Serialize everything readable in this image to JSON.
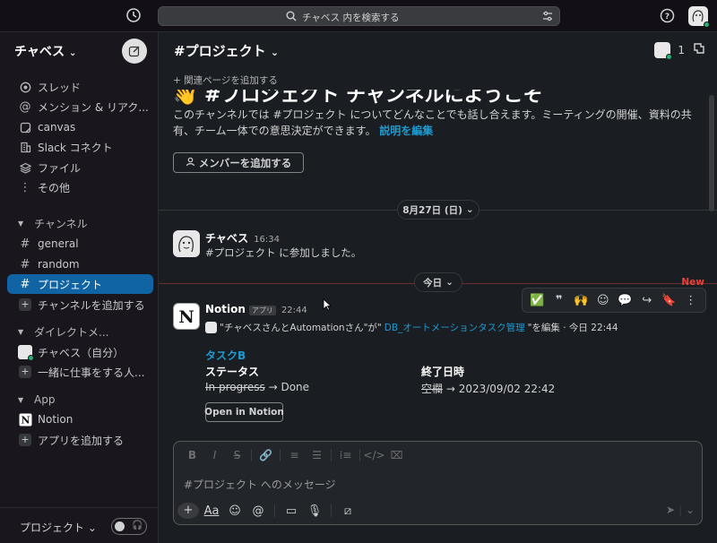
{
  "topbar": {
    "search_placeholder": "チャベス 内を検索する",
    "icons": [
      "history-icon",
      "search-icon",
      "filter-icon",
      "help-icon"
    ]
  },
  "workspace": {
    "name": "チャベス",
    "chevron": "⌄"
  },
  "sidebar": {
    "top_items": [
      {
        "label": "スレッド",
        "icon": "threads-icon"
      },
      {
        "label": "メンション & リアク...",
        "icon": "mention-icon"
      },
      {
        "label": "canvas",
        "icon": "canvas-icon"
      },
      {
        "label": "Slack コネクト",
        "icon": "building-icon"
      },
      {
        "label": "ファイル",
        "icon": "files-icon"
      },
      {
        "label": "その他",
        "icon": "more-vertical-icon"
      }
    ],
    "channels_header": "チャンネル",
    "channels": [
      {
        "label": "general",
        "active": false
      },
      {
        "label": "random",
        "active": false
      },
      {
        "label": "プロジェクト",
        "active": true
      }
    ],
    "add_channel": "チャンネルを追加する",
    "dm_header": "ダイレクトメ...",
    "dms": [
      {
        "label": "チャベス（自分）"
      },
      {
        "label": "一緒に仕事をする人..."
      }
    ],
    "app_header": "App",
    "apps": [
      {
        "label": "Notion"
      }
    ],
    "add_app": "アプリを追加する",
    "footer": {
      "name": "プロジェクト",
      "chevron": "⌄"
    }
  },
  "channel": {
    "title": "#プロジェクト",
    "chevron": "⌄",
    "member_count": "1",
    "add_bookmark": "関連ページを追加する",
    "intro_title": "👋 #プロジェクト チャンネルにようこそ",
    "intro_desc": "このチャンネルでは #プロジェクト についてどんなことでも話し合えます。ミーティングの開催、資料の共有、チーム一体での意思決定ができます。",
    "edit_desc_link": "説明を編集",
    "add_member_button": "メンバーを追加する"
  },
  "messages": {
    "date_divider_1": "8月27日 (日)",
    "msg1": {
      "author": "チャベス",
      "time": "16:34",
      "text": "#プロジェクト に参加しました。"
    },
    "date_divider_2": "今日",
    "new_label": "New",
    "msg2": {
      "author": "Notion",
      "badge": "アプリ",
      "time": "22:44",
      "line_prefix": "\"チャベスさんとAutomationさん\"が\"",
      "line_link": "DB_オートメーションタスク管理",
      "line_suffix": "\"を編集 · 今日 22:44",
      "task_title": "タスクB",
      "status_label": "ステータス",
      "status_old": "In progress",
      "status_new": "→ Done",
      "due_label": "終了日時",
      "due_old": "空欄",
      "due_new": "→ 2023/09/02 22:42",
      "open_button": "Open in Notion"
    }
  },
  "hover_actions": [
    "✅",
    "❞",
    "🙌",
    "add-reaction-icon",
    "reply-thread-icon",
    "share-icon",
    "bookmark-icon",
    "more-icon"
  ],
  "composer": {
    "placeholder": "#プロジェクト へのメッセージ",
    "format_icons": [
      "bold-icon",
      "italic-icon",
      "strike-icon",
      "link-icon",
      "ordered-list-icon",
      "bullet-list-icon",
      "block-quote-icon",
      "code-icon",
      "code-block-icon"
    ],
    "action_icons": [
      "plus-icon",
      "text-format-icon",
      "emoji-icon",
      "mention-icon",
      "video-icon",
      "mic-icon",
      "slash-icon"
    ]
  },
  "colors": {
    "active_item": "#1164a3",
    "link": "#1d9bd1",
    "new_marker": "#e8433b",
    "background": "#1a1d21",
    "sidebar": "#19171d"
  }
}
